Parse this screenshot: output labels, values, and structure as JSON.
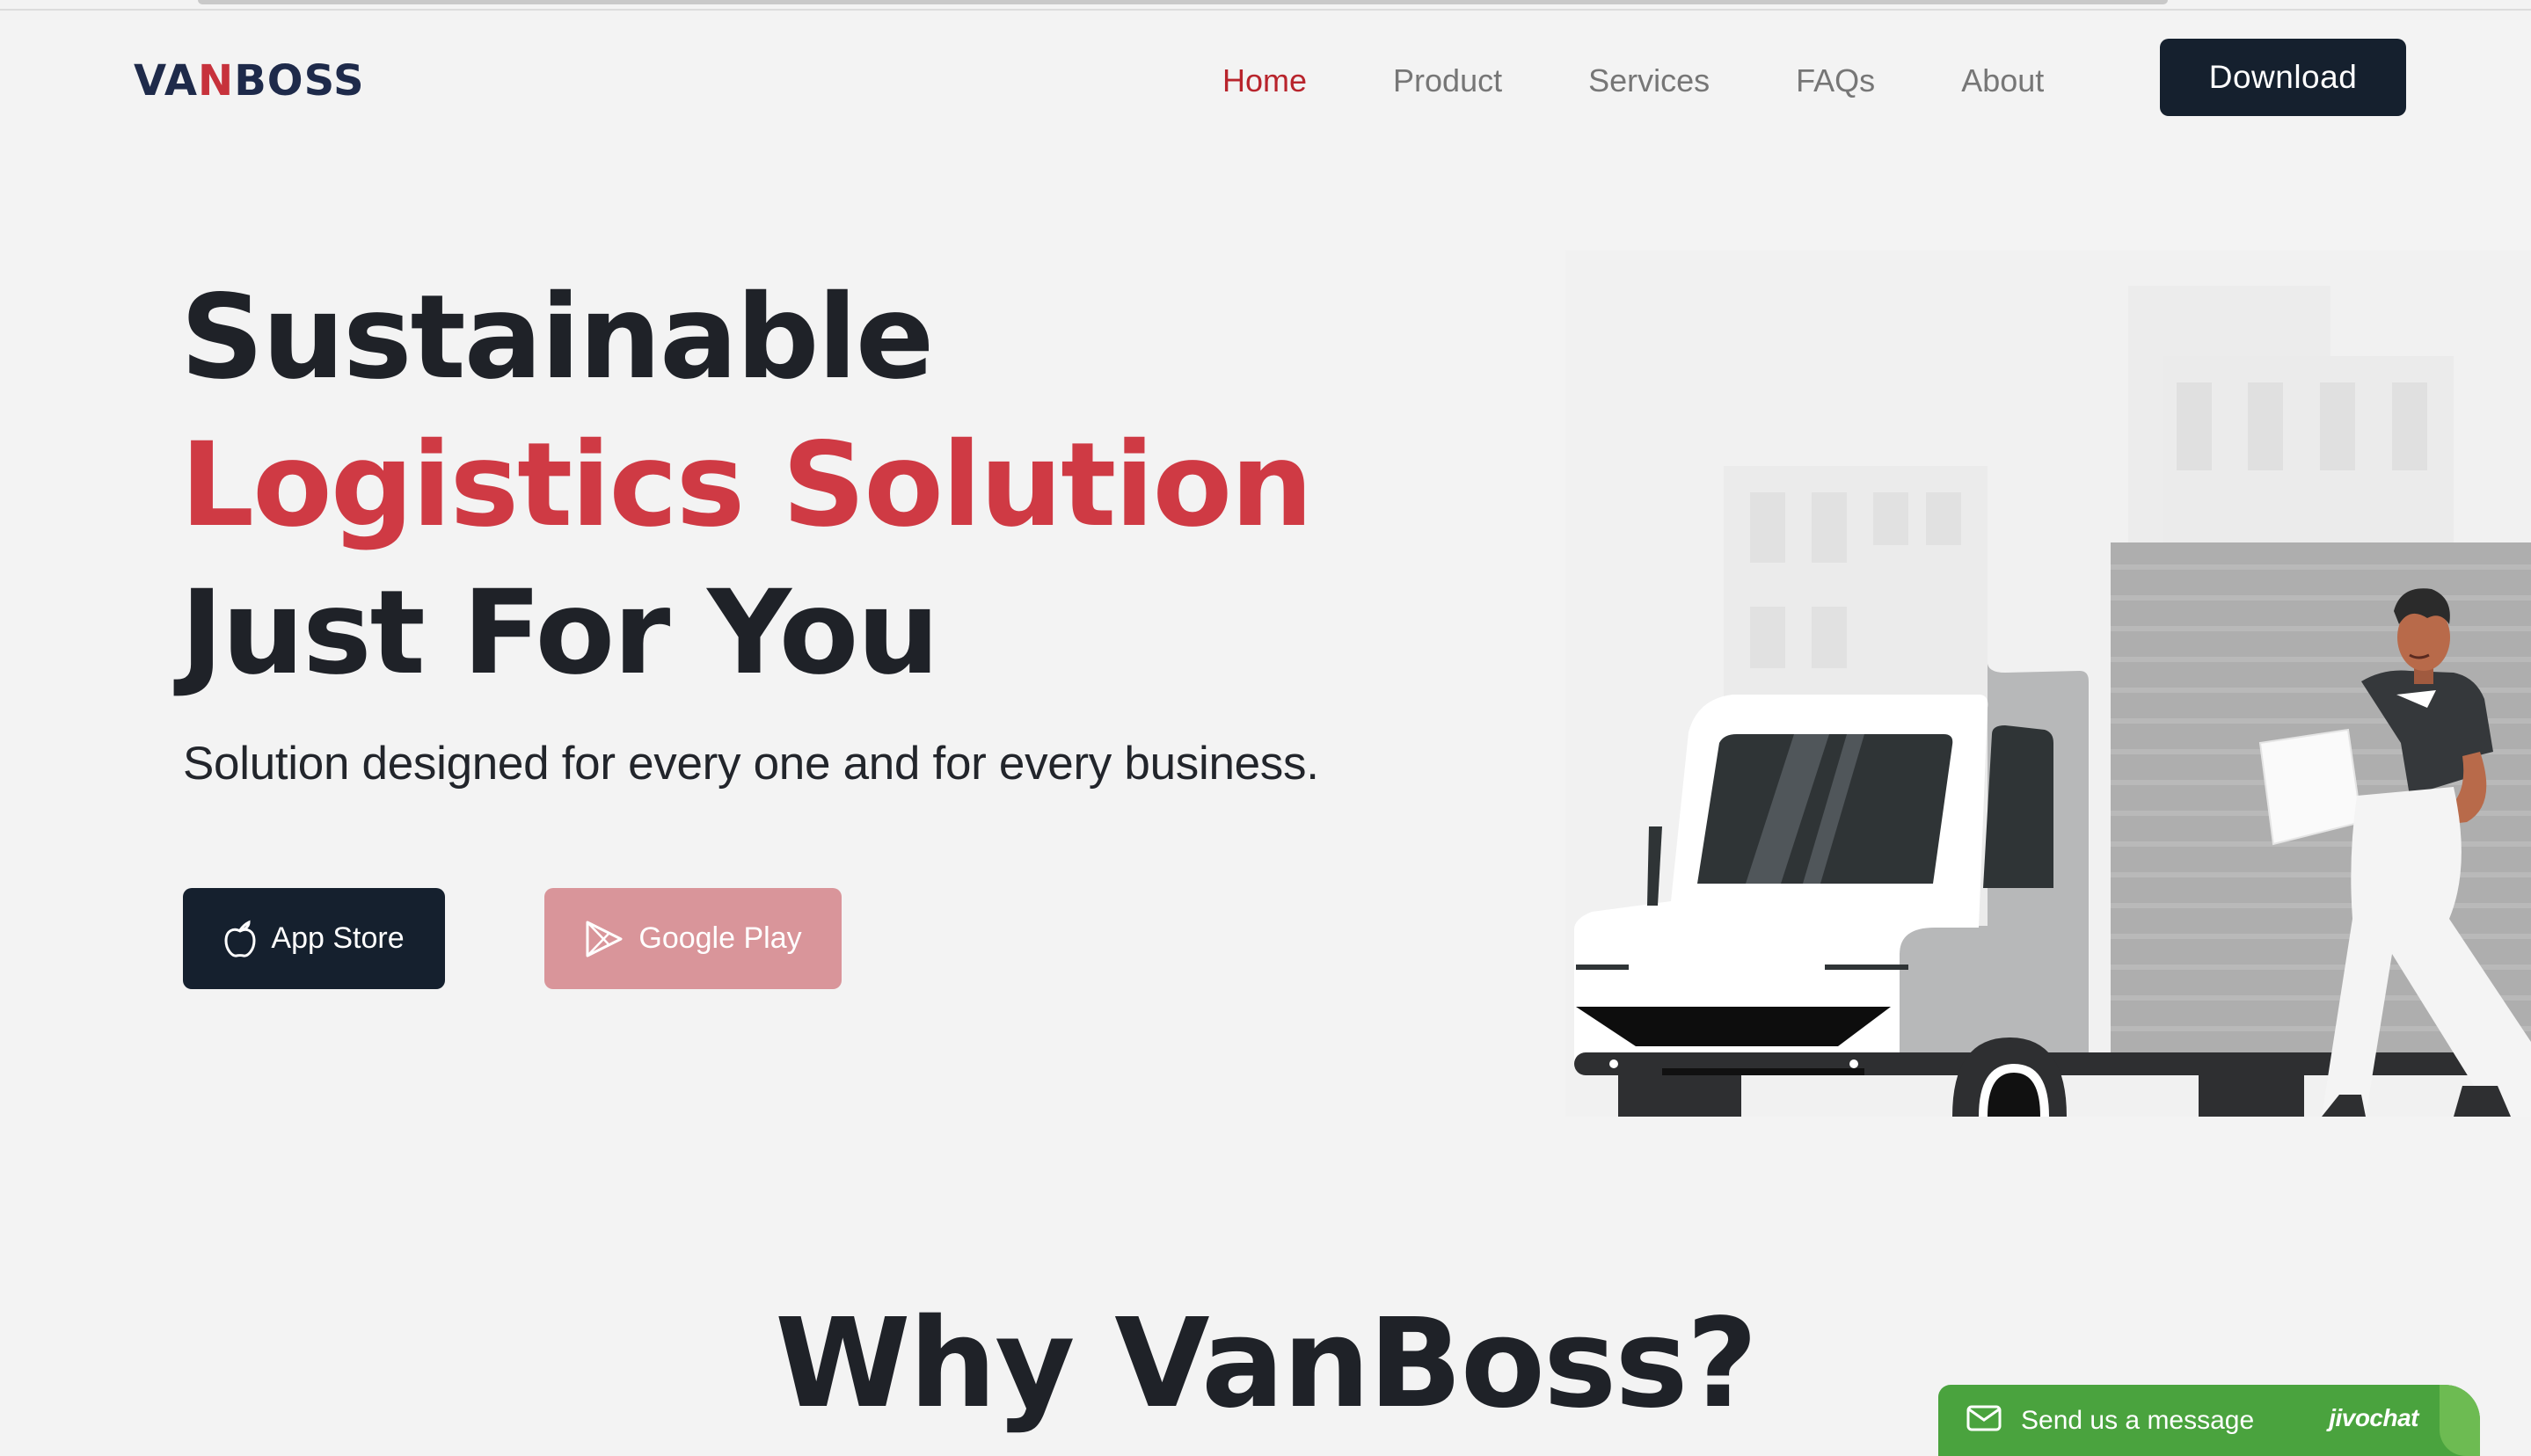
{
  "nav": {
    "logo": {
      "left": "VA",
      "mark": "N",
      "right": "BOSS"
    },
    "links": [
      {
        "label": "Home",
        "active": true
      },
      {
        "label": "Product",
        "active": false
      },
      {
        "label": "Services",
        "active": false
      },
      {
        "label": "FAQs",
        "active": false
      },
      {
        "label": "About",
        "active": false
      }
    ],
    "download_label": "Download"
  },
  "hero": {
    "line1": "Sustainable",
    "line2": "Logistics Solution",
    "line3": "Just For You",
    "subtitle": "Solution designed for every one and for every business.",
    "appstore_label": "App Store",
    "googleplay_label": "Google Play"
  },
  "why": {
    "title": "Why VanBoss?"
  },
  "chat": {
    "label": "Send us a message",
    "brand": "jivochat"
  },
  "colors": {
    "accent_red": "#cf3a44",
    "nav_active": "#b8242c",
    "dark_navy": "#15202e",
    "google_play_pink": "#d9959a",
    "chat_green": "#4aa33e"
  },
  "icons": [
    "apple-icon",
    "play-icon",
    "mail-icon"
  ]
}
